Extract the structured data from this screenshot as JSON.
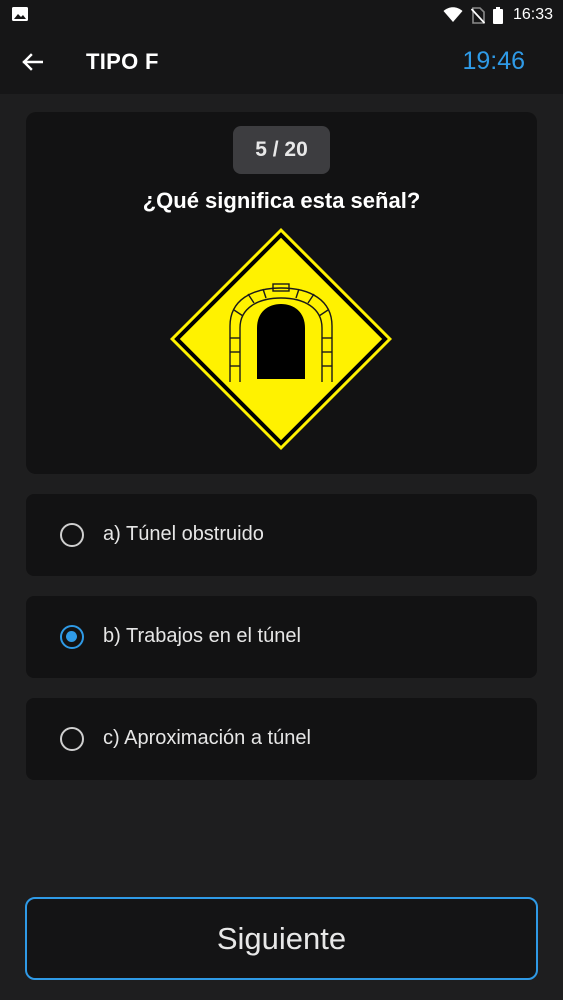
{
  "status_bar": {
    "time": "16:33",
    "icons": [
      "gallery-icon",
      "wifi-icon",
      "no-sim-icon",
      "battery-icon"
    ]
  },
  "app_bar": {
    "title": "TIPO F",
    "timer": "19:46",
    "back_icon": "arrow-left-icon"
  },
  "question": {
    "counter": "5 / 20",
    "text": "¿Qué significa esta señal?",
    "image": "tunnel-warning-sign"
  },
  "options": [
    {
      "label": "a) Túnel obstruido",
      "selected": false
    },
    {
      "label": "b) Trabajos en el túnel",
      "selected": true
    },
    {
      "label": "c) Aproximación a túnel",
      "selected": false
    }
  ],
  "next_button": {
    "label": "Siguiente"
  },
  "colors": {
    "accent": "#2f9ae6",
    "background": "#1e1e1f",
    "card": "#121213",
    "sign_yellow": "#fff200"
  }
}
